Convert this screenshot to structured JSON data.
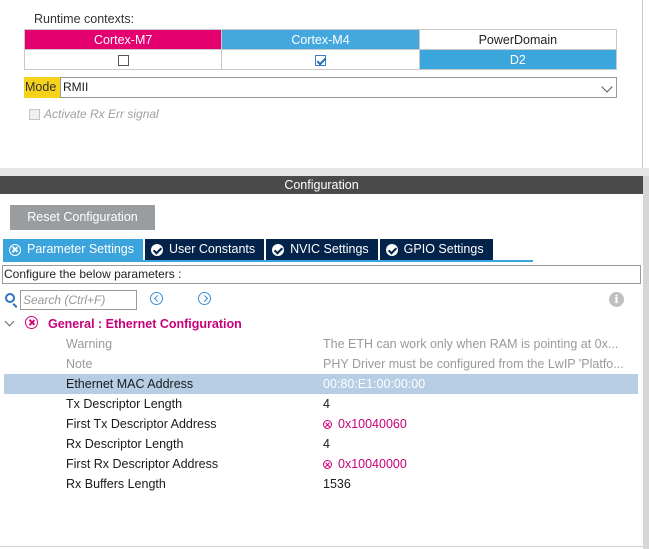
{
  "runtime": {
    "label": "Runtime contexts:",
    "contexts": [
      {
        "name": "Cortex-M7",
        "checked": false,
        "color": "#e4006f"
      },
      {
        "name": "Cortex-M4",
        "checked": true,
        "color": "#44a8df"
      },
      {
        "name": "PowerDomain",
        "value": "D2"
      }
    ]
  },
  "mode": {
    "label": "Mode",
    "value": "RMII"
  },
  "rx_err": {
    "label": "Activate Rx Err signal",
    "checked": false,
    "enabled": false
  },
  "configuration": {
    "header": "Configuration",
    "reset_label": "Reset Configuration",
    "tabs": [
      {
        "label": "Parameter Settings",
        "icon": "error-icon",
        "active": true
      },
      {
        "label": "User Constants",
        "icon": "check-icon",
        "active": false
      },
      {
        "label": "NVIC Settings",
        "icon": "check-icon",
        "active": false
      },
      {
        "label": "GPIO Settings",
        "icon": "check-icon",
        "active": false
      }
    ],
    "description": "Configure the below parameters :",
    "search_placeholder": "Search (Ctrl+F)",
    "group": {
      "title": "General : Ethernet Configuration",
      "params": [
        {
          "name": "Warning",
          "value": "The ETH can work only when RAM is pointing at 0x...",
          "dim": true,
          "error": false,
          "selected": false
        },
        {
          "name": "Note",
          "value": "PHY Driver must be configured from the LwIP 'Platfo...",
          "dim": true,
          "error": false,
          "selected": false
        },
        {
          "name": "Ethernet MAC Address",
          "value": "00:80:E1:00:00:00",
          "dim": false,
          "error": false,
          "selected": true
        },
        {
          "name": "Tx Descriptor Length",
          "value": "4",
          "dim": false,
          "error": false,
          "selected": false
        },
        {
          "name": "First Tx Descriptor Address",
          "value": "0x10040060",
          "dim": false,
          "error": true,
          "selected": false
        },
        {
          "name": "Rx Descriptor Length",
          "value": "4",
          "dim": false,
          "error": false,
          "selected": false
        },
        {
          "name": "First Rx Descriptor Address",
          "value": "0x10040000",
          "dim": false,
          "error": true,
          "selected": false
        },
        {
          "name": "Rx Buffers Length",
          "value": "1536",
          "dim": false,
          "error": false,
          "selected": false
        }
      ]
    }
  }
}
